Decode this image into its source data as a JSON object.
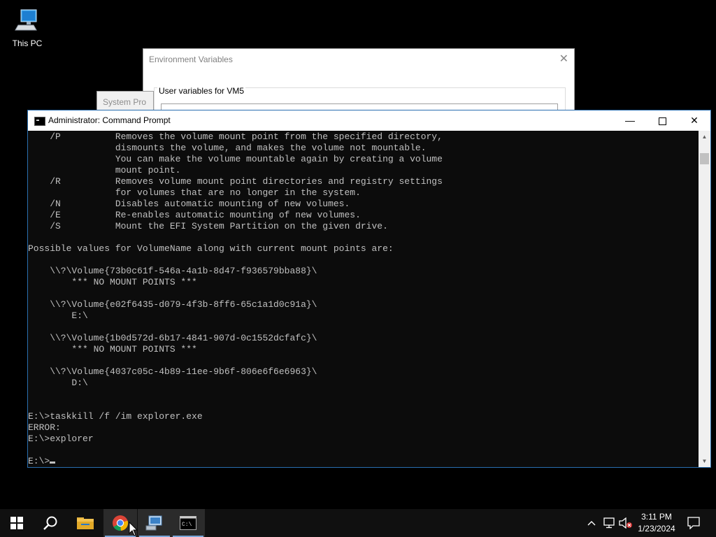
{
  "desktop": {
    "this_pc_label": "This PC"
  },
  "env_window": {
    "title": "Environment Variables",
    "user_vars_label": "User variables for VM5"
  },
  "sysprop_window": {
    "title": "System Pro"
  },
  "cmd": {
    "title": "Administrator: Command Prompt",
    "lines": [
      "    /P          Removes the volume mount point from the specified directory,",
      "                dismounts the volume, and makes the volume not mountable.",
      "                You can make the volume mountable again by creating a volume",
      "                mount point.",
      "    /R          Removes volume mount point directories and registry settings",
      "                for volumes that are no longer in the system.",
      "    /N          Disables automatic mounting of new volumes.",
      "    /E          Re-enables automatic mounting of new volumes.",
      "    /S          Mount the EFI System Partition on the given drive.",
      "",
      "Possible values for VolumeName along with current mount points are:",
      "",
      "    \\\\?\\Volume{73b0c61f-546a-4a1b-8d47-f936579bba88}\\",
      "        *** NO MOUNT POINTS ***",
      "",
      "    \\\\?\\Volume{e02f6435-d079-4f3b-8ff6-65c1a1d0c91a}\\",
      "        E:\\",
      "",
      "    \\\\?\\Volume{1b0d572d-6b17-4841-907d-0c1552dcfafc}\\",
      "        *** NO MOUNT POINTS ***",
      "",
      "    \\\\?\\Volume{4037c05c-4b89-11ee-9b6f-806e6f6e6963}\\",
      "        D:\\",
      "",
      "",
      "E:\\>taskkill /f /im explorer.exe",
      "ERROR:",
      "E:\\>explorer",
      ""
    ],
    "prompt": "E:\\>"
  },
  "taskbar": {
    "time": "3:11 PM",
    "date": "1/23/2024",
    "items": [
      "start-icon",
      "search-icon",
      "file-explorer-icon",
      "chrome-icon",
      "remote-desktop-icon",
      "command-prompt-icon"
    ]
  },
  "colors": {
    "console_bg": "#0c0c0c",
    "console_fg": "#c0c0c0",
    "taskbar_bg": "#101010"
  }
}
